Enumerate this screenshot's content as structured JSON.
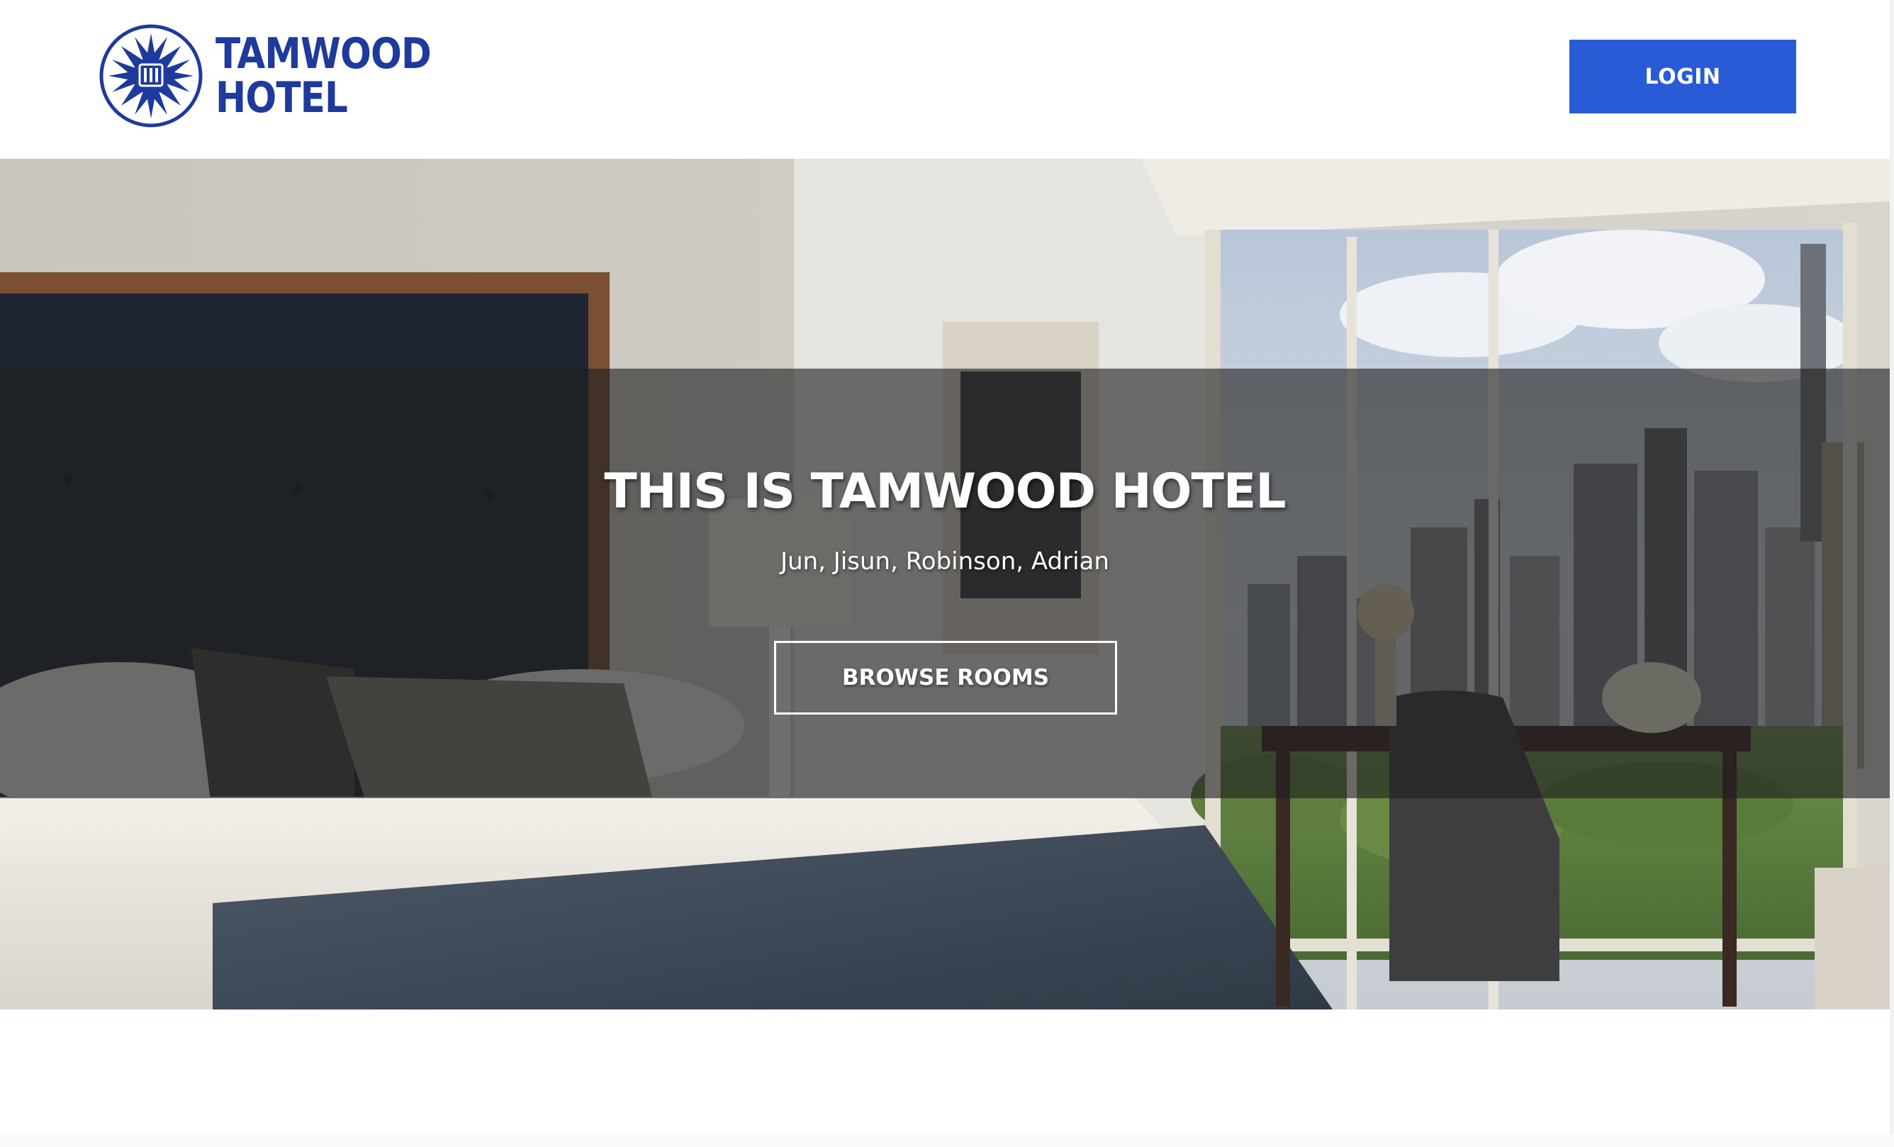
{
  "header": {
    "logo_line1": "TAMWOOD",
    "logo_line2": "HOTEL",
    "login_label": "LOGIN"
  },
  "hero": {
    "title": "THIS IS TAMWOOD HOTEL",
    "subtitle": "Jun, Jisun, Robinson, Adrian",
    "browse_label": "BROWSE ROOMS"
  },
  "colors": {
    "brand_blue": "#1e3a9c",
    "button_blue": "#2a5bd7",
    "overlay": "rgba(30,30,30,0.62)"
  },
  "icons": {
    "logo": "hotel-emblem-icon"
  }
}
